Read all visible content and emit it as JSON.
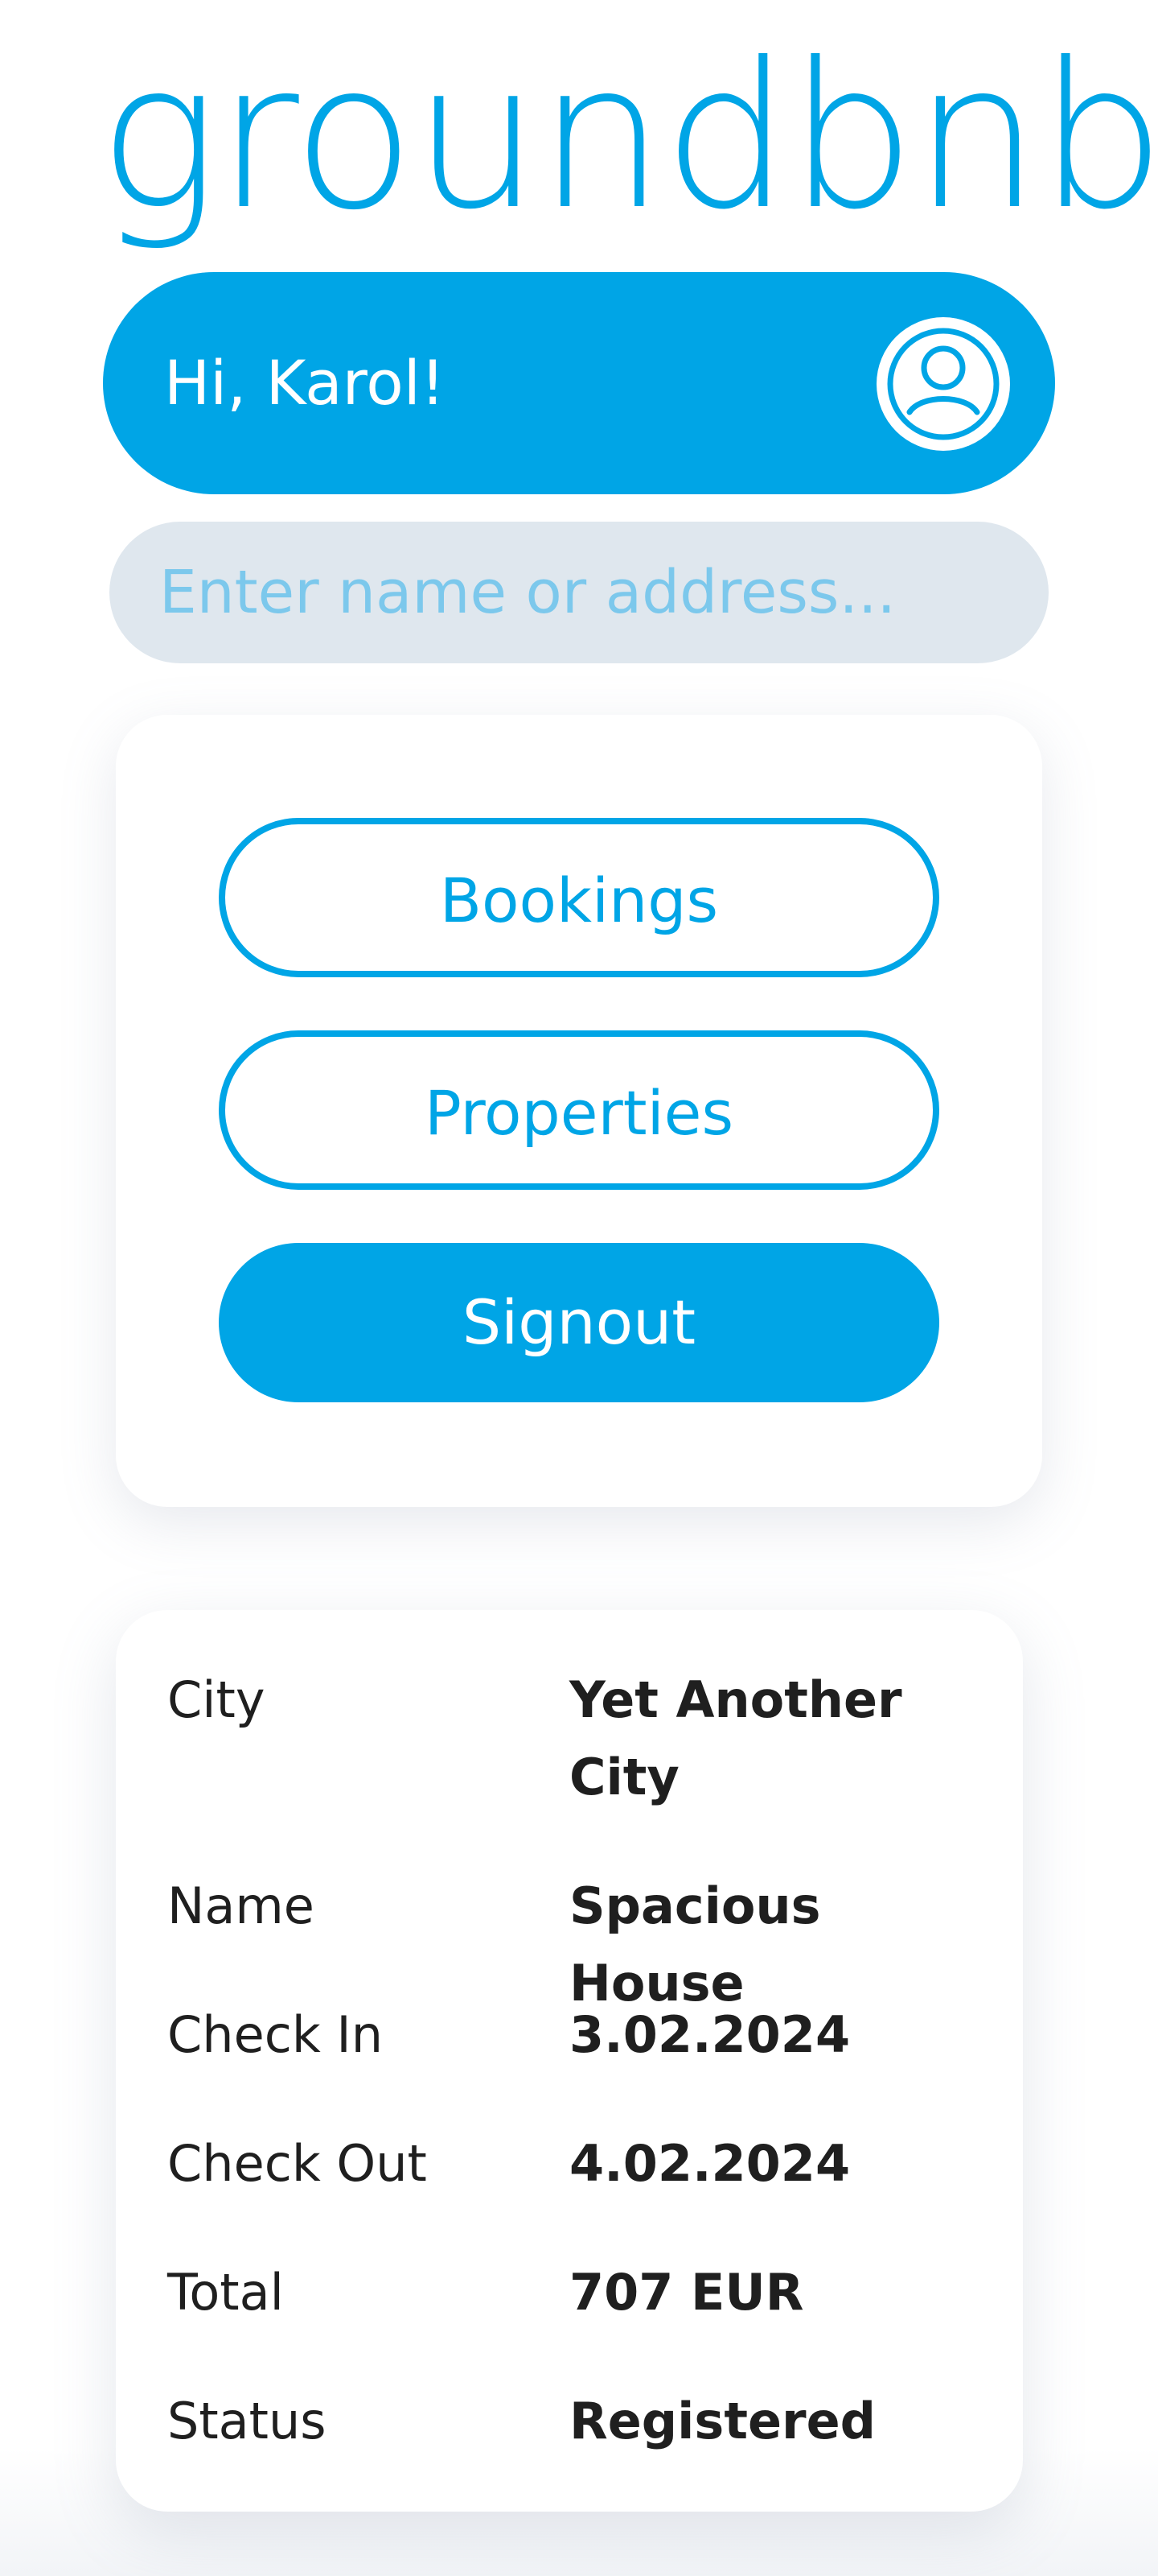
{
  "app": {
    "logo_text": "groundbnb"
  },
  "header": {
    "greeting": "Hi, Karol!",
    "avatar_icon": "user-icon"
  },
  "search": {
    "placeholder": "Enter name or address...",
    "value": ""
  },
  "menu": {
    "bookings_label": "Bookings",
    "properties_label": "Properties",
    "signout_label": "Signout"
  },
  "booking": {
    "rows": [
      {
        "label": "City",
        "value": "Yet Another City"
      },
      {
        "label": "Name",
        "value": "Spacious House"
      },
      {
        "label": "Check In",
        "value": "3.02.2024"
      },
      {
        "label": "Check Out",
        "value": "4.02.2024"
      },
      {
        "label": "Total",
        "value": "707 EUR"
      },
      {
        "label": "Status",
        "value": "Registered"
      }
    ]
  },
  "colors": {
    "accent": "#00a5e6",
    "search_bg": "#dfe7ee",
    "placeholder": "#7cc8ec",
    "text": "#1f1f1f"
  }
}
